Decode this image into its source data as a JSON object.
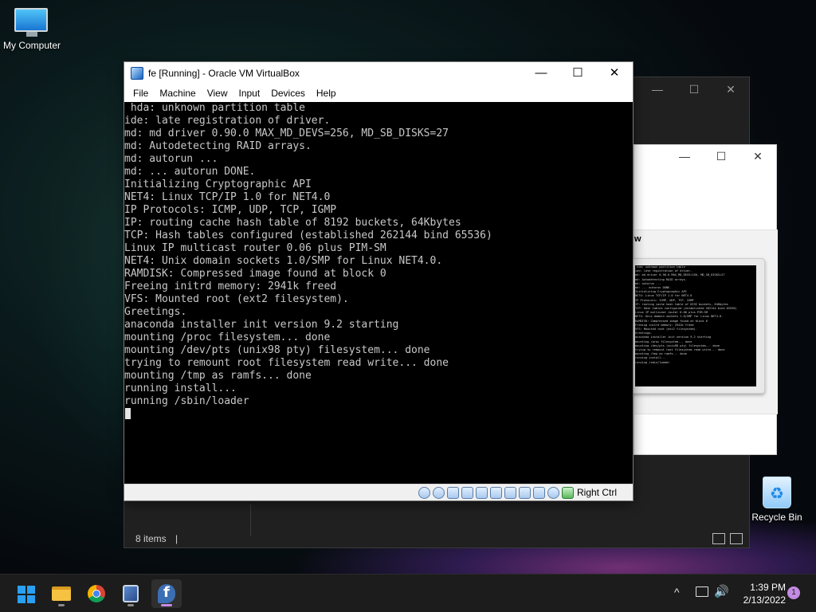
{
  "desktop": {
    "icons": [
      {
        "label": "My Computer"
      },
      {
        "label": "Recycle Bin"
      }
    ]
  },
  "explorer": {
    "status_text": "8 items",
    "controls": [
      "—",
      "☐",
      "✕"
    ]
  },
  "dialog": {
    "controls": [
      "—",
      "☐",
      "✕"
    ],
    "heading_fragment": "w"
  },
  "vbox": {
    "title": "fe [Running] - Oracle VM VirtualBox",
    "controls": {
      "minimize": "—",
      "maximize": "☐",
      "close": "✕"
    },
    "menu": [
      "File",
      "Machine",
      "View",
      "Input",
      "Devices",
      "Help"
    ],
    "console_lines": [
      " hda: unknown partition table",
      "ide: late registration of driver.",
      "md: md driver 0.90.0 MAX_MD_DEVS=256, MD_SB_DISKS=27",
      "md: Autodetecting RAID arrays.",
      "md: autorun ...",
      "md: ... autorun DONE.",
      "Initializing Cryptographic API",
      "NET4: Linux TCP/IP 1.0 for NET4.0",
      "IP Protocols: ICMP, UDP, TCP, IGMP",
      "IP: routing cache hash table of 8192 buckets, 64Kbytes",
      "TCP: Hash tables configured (established 262144 bind 65536)",
      "Linux IP multicast router 0.06 plus PIM-SM",
      "NET4: Unix domain sockets 1.0/SMP for Linux NET4.0.",
      "RAMDISK: Compressed image found at block 0",
      "Freeing initrd memory: 2941k freed",
      "VFS: Mounted root (ext2 filesystem).",
      "Greetings.",
      "anaconda installer init version 9.2 starting",
      "mounting /proc filesystem... done",
      "mounting /dev/pts (unix98 pty) filesystem... done",
      "trying to remount root filesystem read write... done",
      "mounting /tmp as ramfs... done",
      "running install...",
      "running /sbin/loader"
    ],
    "host_key": "Right Ctrl"
  },
  "taskbar": {
    "clock_time": "1:39 PM",
    "clock_date": "2/13/2022",
    "notification_count": "1",
    "tray_chevron": "^",
    "volume_glyph": "🔊"
  },
  "colors": {
    "accent": "#c38be3",
    "console_bg": "#000000",
    "console_text": "#c8c8c8"
  }
}
